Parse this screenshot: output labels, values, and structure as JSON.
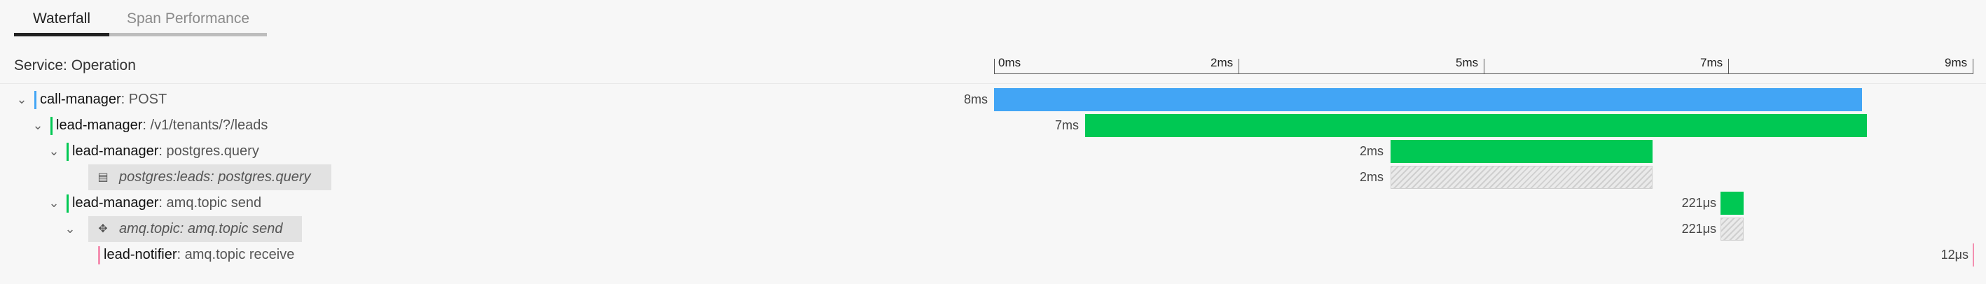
{
  "tabs": [
    {
      "label": "Waterfall",
      "active": true
    },
    {
      "label": "Span Performance",
      "active": false
    }
  ],
  "header": {
    "label": "Service: Operation"
  },
  "axis": {
    "ticks": [
      "0ms",
      "2ms",
      "5ms",
      "7ms",
      "9ms"
    ]
  },
  "colors": {
    "blue": "#42a5f5",
    "green": "#00c853",
    "pink": "#f48fb1"
  },
  "rows": [
    {
      "service": "call-manager",
      "operation": ": POST",
      "duration": "8ms",
      "chevron": "chevron-down-icon"
    },
    {
      "service": "lead-manager",
      "operation": ": /v1/tenants/?/leads",
      "duration": "7ms",
      "chevron": "chevron-down-icon"
    },
    {
      "service": "lead-manager",
      "operation": ": postgres.query",
      "duration": "2ms",
      "chevron": "chevron-down-icon"
    },
    {
      "service": "postgres:leads",
      "operation": ": postgres.query",
      "duration": "2ms",
      "icon": "database-icon"
    },
    {
      "service": "lead-manager",
      "operation": ": amq.topic send",
      "duration": "221μs",
      "chevron": "chevron-down-icon"
    },
    {
      "service": "amq.topic",
      "operation": ": amq.topic send",
      "duration": "221μs",
      "icon": "queue-icon",
      "chevron": "chevron-down-icon"
    },
    {
      "service": "lead-notifier",
      "operation": ": amq.topic receive",
      "duration": "12μs"
    }
  ]
}
